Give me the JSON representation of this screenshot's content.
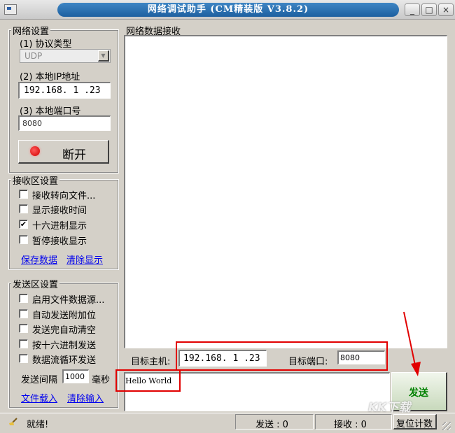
{
  "window": {
    "title": "网络调试助手 (CM精装版 V3.8.2)"
  },
  "network_settings": {
    "group_label": "网络设置",
    "protocol_label": "(1) 协议类型",
    "protocol_value": "UDP",
    "local_ip_label": "(2) 本地IP地址",
    "local_ip": "192.168. 1 .23",
    "local_port_label": "(3) 本地端口号",
    "local_port": "8080",
    "disconnect_label": "断开"
  },
  "receive_settings": {
    "group_label": "接收区设置",
    "options": [
      {
        "label": "接收转向文件...",
        "checked": false
      },
      {
        "label": "显示接收时间",
        "checked": false
      },
      {
        "label": "十六进制显示",
        "checked": true
      },
      {
        "label": "暂停接收显示",
        "checked": false
      }
    ],
    "save_link": "保存数据",
    "clear_link": "清除显示"
  },
  "send_settings": {
    "group_label": "发送区设置",
    "options": [
      {
        "label": "启用文件数据源...",
        "checked": false
      },
      {
        "label": "自动发送附加位",
        "checked": false
      },
      {
        "label": "发送完自动清空",
        "checked": false
      },
      {
        "label": "按十六进制发送",
        "checked": false
      },
      {
        "label": "数据流循环发送",
        "checked": false
      }
    ],
    "interval_label": "发送间隔",
    "interval_value": "1000",
    "interval_unit": "毫秒",
    "load_file_link": "文件载入",
    "clear_input_link": "清除输入"
  },
  "receive_area": {
    "label": "网络数据接收",
    "content": ""
  },
  "target": {
    "host_label": "目标主机:",
    "host_value": "192.168. 1 .23",
    "port_label": "目标端口:",
    "port_value": "8080"
  },
  "send_area": {
    "content": "Hello World",
    "send_button": "发送"
  },
  "status_bar": {
    "status_text": "就绪!",
    "sent_label": "发送 : 0",
    "received_label": "接收 : 0",
    "reset_button": "复位计数"
  },
  "watermark": {
    "text": "KK下载"
  },
  "colors": {
    "annotation_red": "#e10000",
    "title_blue": "#2a6db0",
    "send_green": "#008000",
    "link_blue": "#0000ee"
  }
}
